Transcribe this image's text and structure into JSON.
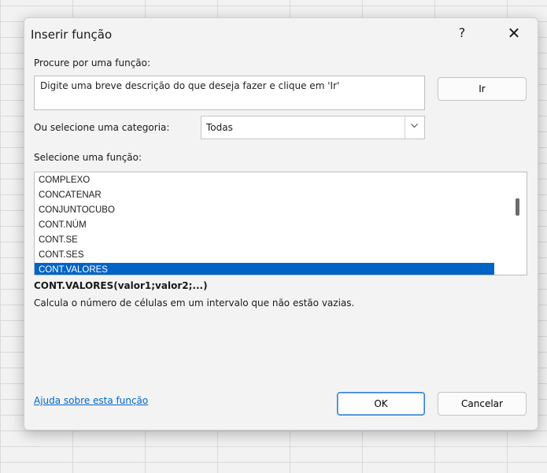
{
  "dialog": {
    "title": "Inserir função",
    "help_label": "?",
    "close_label": "✕"
  },
  "search": {
    "label": "Procure por uma função:",
    "value": "Digite uma breve descrição do que deseja fazer e clique em 'Ir'",
    "go_label": "Ir"
  },
  "category": {
    "label": "Ou selecione uma categoria:",
    "selected": "Todas",
    "chevron_icon": "chevron-down-icon"
  },
  "functions": {
    "label": "Selecione uma função:",
    "items": [
      "COMPLEXO",
      "CONCATENAR",
      "CONJUNTOCUBO",
      "CONT.NÚM",
      "CONT.SE",
      "CONT.SES",
      "CONT.VALORES"
    ],
    "selected_index": 6
  },
  "selected_function": {
    "signature": "CONT.VALORES(valor1;valor2;...)",
    "description": "Calcula o número de células em um intervalo que não estão vazias."
  },
  "footer": {
    "help_link": "Ajuda sobre esta função",
    "ok_label": "OK",
    "cancel_label": "Cancelar"
  },
  "colors": {
    "selection": "#0063c6",
    "link": "#0066cc"
  }
}
